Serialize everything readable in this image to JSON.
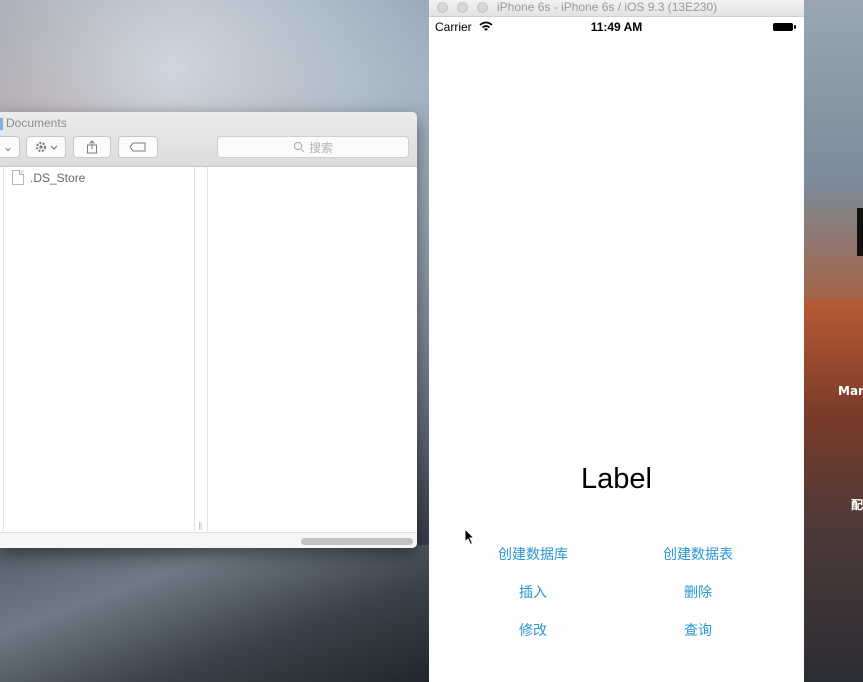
{
  "desktop": {
    "labels": [
      "Mar",
      "配"
    ]
  },
  "finder": {
    "title": "Documents",
    "search_placeholder": "搜索",
    "files": [
      ".DS_Store"
    ],
    "icons": {
      "action": "gear-icon",
      "share": "share-icon",
      "tag": "tag-icon",
      "search": "search-icon"
    }
  },
  "simulator": {
    "window_title": "iPhone 6s - iPhone 6s / iOS 9.3 (13E230)",
    "status_bar": {
      "carrier": "Carrier",
      "time": "11:49 AM"
    },
    "label": "Label",
    "buttons": {
      "create_db": "创建数据库",
      "create_table": "创建数据表",
      "insert": "插入",
      "delete": "删除",
      "update": "修改",
      "query": "查询"
    },
    "accent_color": "#2a96d6"
  }
}
